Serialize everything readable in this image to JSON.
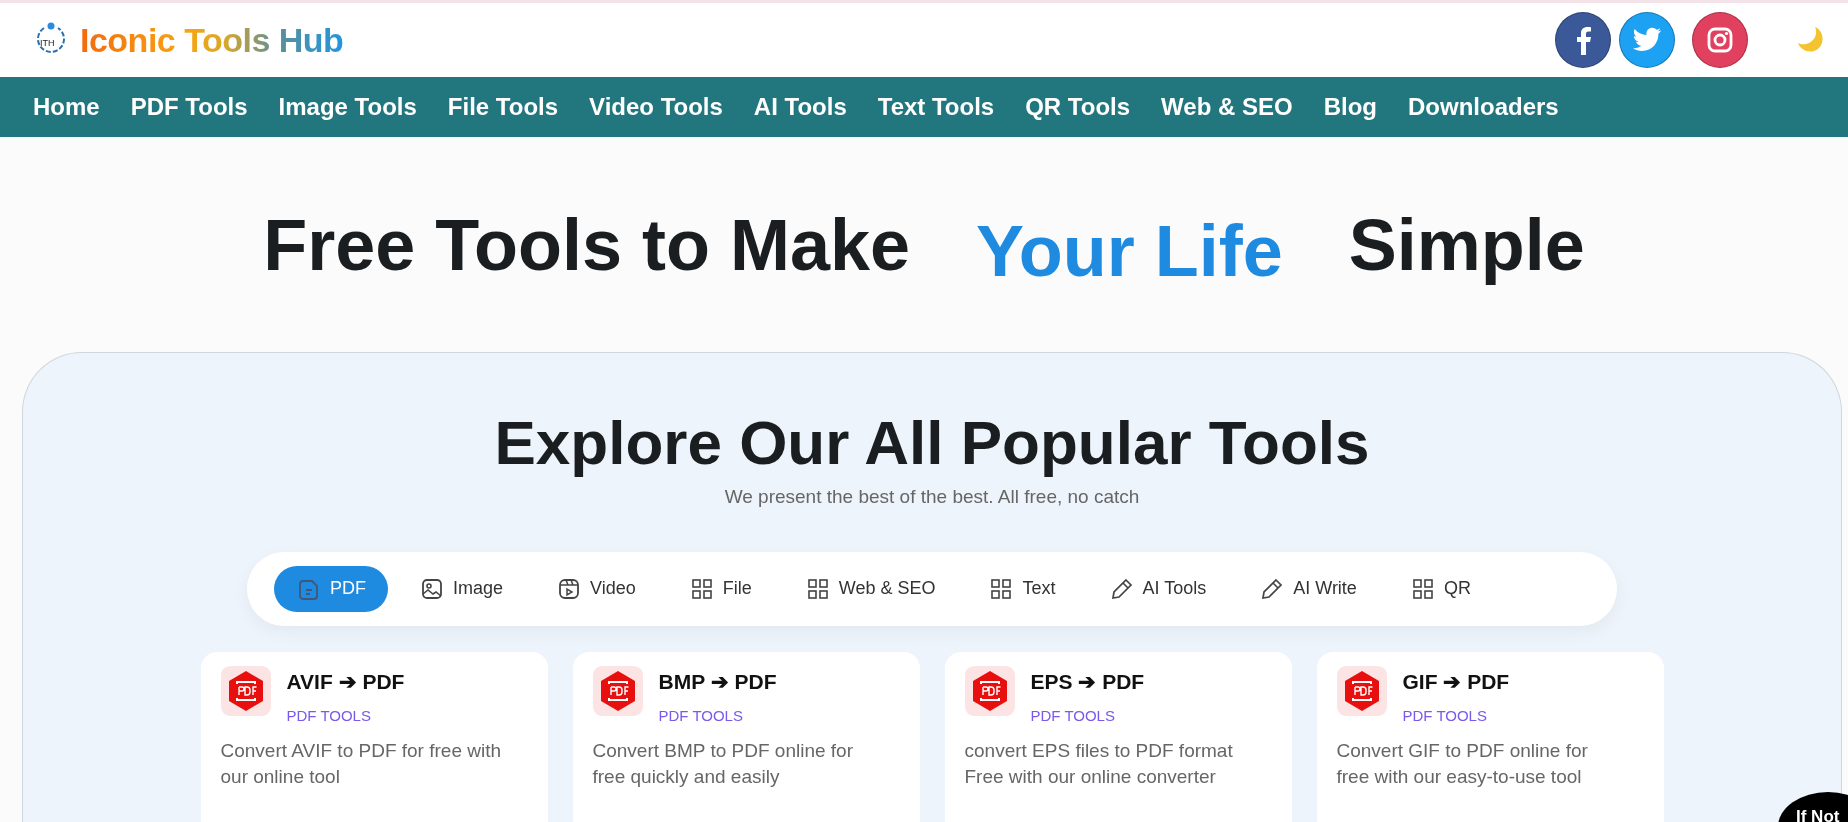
{
  "brand": {
    "mark": "ITH",
    "name": "Iconic Tools Hub"
  },
  "nav": [
    "Home",
    "PDF Tools",
    "Image Tools",
    "File Tools",
    "Video Tools",
    "AI Tools",
    "Text Tools",
    "QR Tools",
    "Web & SEO",
    "Blog",
    "Downloaders"
  ],
  "hero": {
    "before": "Free Tools to Make",
    "highlight": "Your Life",
    "after": "Simple"
  },
  "section": {
    "title": "Explore Our All Popular Tools",
    "subtitle": "We present the best of the best. All free, no catch"
  },
  "tabs": [
    {
      "label": "PDF",
      "kind": "document",
      "selected": true
    },
    {
      "label": "Image",
      "kind": "image",
      "selected": false
    },
    {
      "label": "Video",
      "kind": "video",
      "selected": false
    },
    {
      "label": "File",
      "kind": "grid",
      "selected": false
    },
    {
      "label": "Web & SEO",
      "kind": "grid",
      "selected": false
    },
    {
      "label": "Text",
      "kind": "grid",
      "selected": false
    },
    {
      "label": "AI Tools",
      "kind": "pencil",
      "selected": false
    },
    {
      "label": "AI Write",
      "kind": "pencil",
      "selected": false
    },
    {
      "label": "QR",
      "kind": "grid",
      "selected": false
    }
  ],
  "cards": [
    {
      "title": "AVIF ➔ PDF",
      "category": "PDF TOOLS",
      "description": "Convert AVIF to PDF for free with our online tool"
    },
    {
      "title": "BMP ➔ PDF",
      "category": "PDF TOOLS",
      "description": "Convert BMP to PDF online for free quickly and easily"
    },
    {
      "title": "EPS ➔ PDF",
      "category": "PDF TOOLS",
      "description": "convert EPS files to PDF format Free with our online converter"
    },
    {
      "title": "GIF ➔ PDF",
      "category": "PDF TOOLS",
      "description": "Convert GIF to PDF online for free with our easy-to-use tool"
    }
  ],
  "corner_badge": "If Not"
}
